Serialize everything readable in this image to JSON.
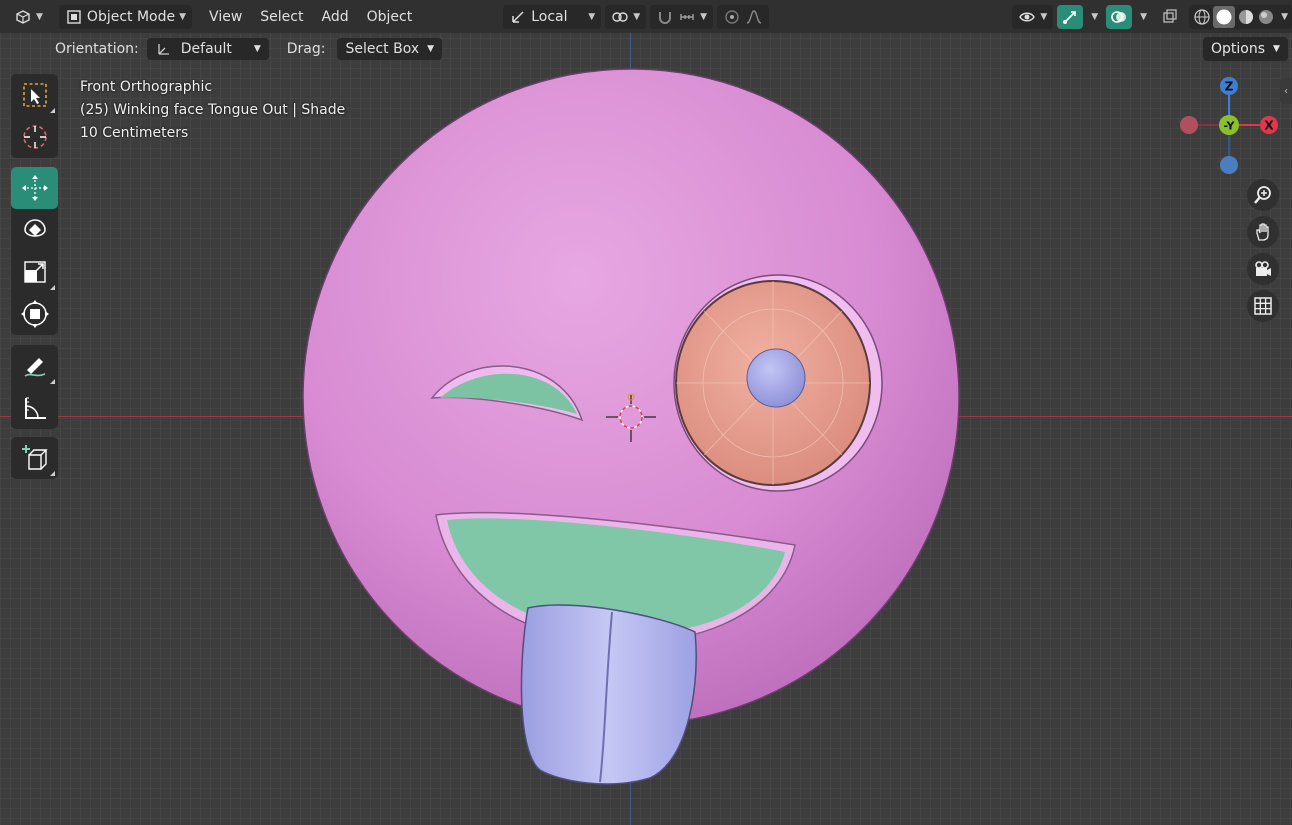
{
  "header": {
    "editor_type_icon": "view3d-icon",
    "mode": "Object Mode",
    "menus": [
      "View",
      "Select",
      "Add",
      "Object"
    ],
    "transform_orientation": "Local",
    "icons": {
      "pivot": "pivot-icon",
      "snap": "snap-magnet-icon",
      "snap_target": "snap-increment-icon",
      "proportional": "proportional-edit-icon",
      "falloff": "falloff-curve-icon",
      "visibility": "eye-icon",
      "gizmos": "gizmo-icon",
      "overlays": "overlays-icon",
      "xray": "xray-icon",
      "shading_wire": "wireframe-shading-icon",
      "shading_solid": "solid-shading-icon",
      "shading_material": "material-shading-icon",
      "shading_rendered": "rendered-shading-icon"
    },
    "accent_color": "#2a8d78"
  },
  "tool_settings": {
    "orientation_label": "Orientation:",
    "orientation_value": "Default",
    "drag_label": "Drag:",
    "drag_value": "Select Box",
    "options_label": "Options"
  },
  "viewport": {
    "view_name": "Front Orthographic",
    "object_info": "(25) Winking face Tongue Out | Shade",
    "scale_info": "10 Centimeters"
  },
  "toolbar": {
    "groups": [
      [
        "select-box-icon",
        "cursor-icon"
      ],
      [
        "move-icon",
        "rotate-icon",
        "scale-icon",
        "transform-icon"
      ],
      [
        "annotate-icon",
        "measure-icon"
      ],
      [
        "add-cube-icon"
      ]
    ],
    "active_tool": "move-icon"
  },
  "gizmo": {
    "axes": [
      "Z",
      "-Y",
      "X"
    ],
    "colors": {
      "x": "#e0374d",
      "y": "#8ac12b",
      "z": "#3e7fd6"
    }
  },
  "nav_buttons": [
    "zoom-icon",
    "hand-pan-icon",
    "camera-icon",
    "grid-ortho-icon"
  ],
  "model": {
    "face_color": "#d98fd0",
    "eye_color": "#e9a08d",
    "pupil_color": "#a7a9e6",
    "mouth_color": "#86c9a9",
    "tongue_color": "#b4b6ee"
  }
}
